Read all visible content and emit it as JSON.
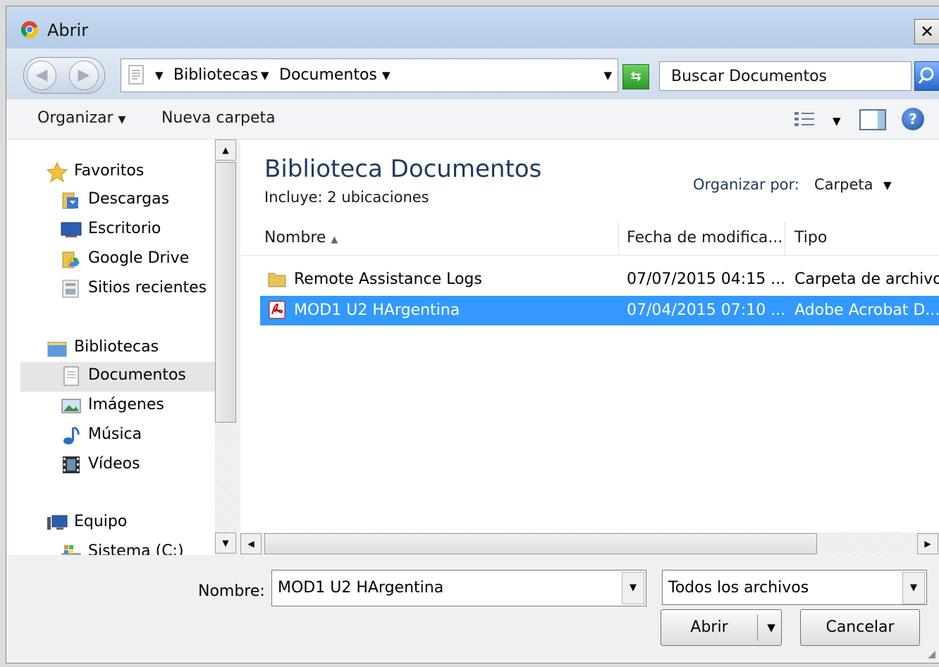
{
  "window": {
    "title": "Abrir",
    "close_glyph": "✕"
  },
  "address_bar": {
    "crumbs": [
      "Bibliotecas",
      "Documentos"
    ],
    "search_placeholder": "Buscar Documentos"
  },
  "toolbar": {
    "organize": "Organizar",
    "new_folder": "Nueva carpeta"
  },
  "nav": {
    "favorites": {
      "label": "Favoritos",
      "items": [
        "Descargas",
        "Escritorio",
        "Google Drive",
        "Sitios recientes"
      ]
    },
    "libraries": {
      "label": "Bibliotecas",
      "items": [
        "Documentos",
        "Imágenes",
        "Música",
        "Vídeos"
      ]
    },
    "computer": {
      "label": "Equipo",
      "items": [
        "Sistema (C:)"
      ]
    },
    "selected": "Documentos"
  },
  "content": {
    "title": "Biblioteca Documentos",
    "subtitle": "Incluye:  2 ubicaciones",
    "arrange_label": "Organizar por:",
    "arrange_value": "Carpeta",
    "columns": {
      "name": "Nombre",
      "date": "Fecha de modifica...",
      "type": "Tipo"
    },
    "files": [
      {
        "name": "Remote Assistance Logs",
        "date": "07/07/2015 04:15 ...",
        "type": "Carpeta de archivos",
        "icon": "folder-icon"
      },
      {
        "name": "MOD1 U2 HArgentina",
        "date": "07/04/2015 07:10 ...",
        "type": "Adobe Acrobat D...",
        "icon": "pdf-icon",
        "selected": true
      }
    ]
  },
  "bottom": {
    "filename_label": "Nombre:",
    "filename_value": "MOD1 U2 HArgentina",
    "filetype_value": "Todos los archivos",
    "open_button": "Abrir",
    "cancel_button": "Cancelar"
  }
}
